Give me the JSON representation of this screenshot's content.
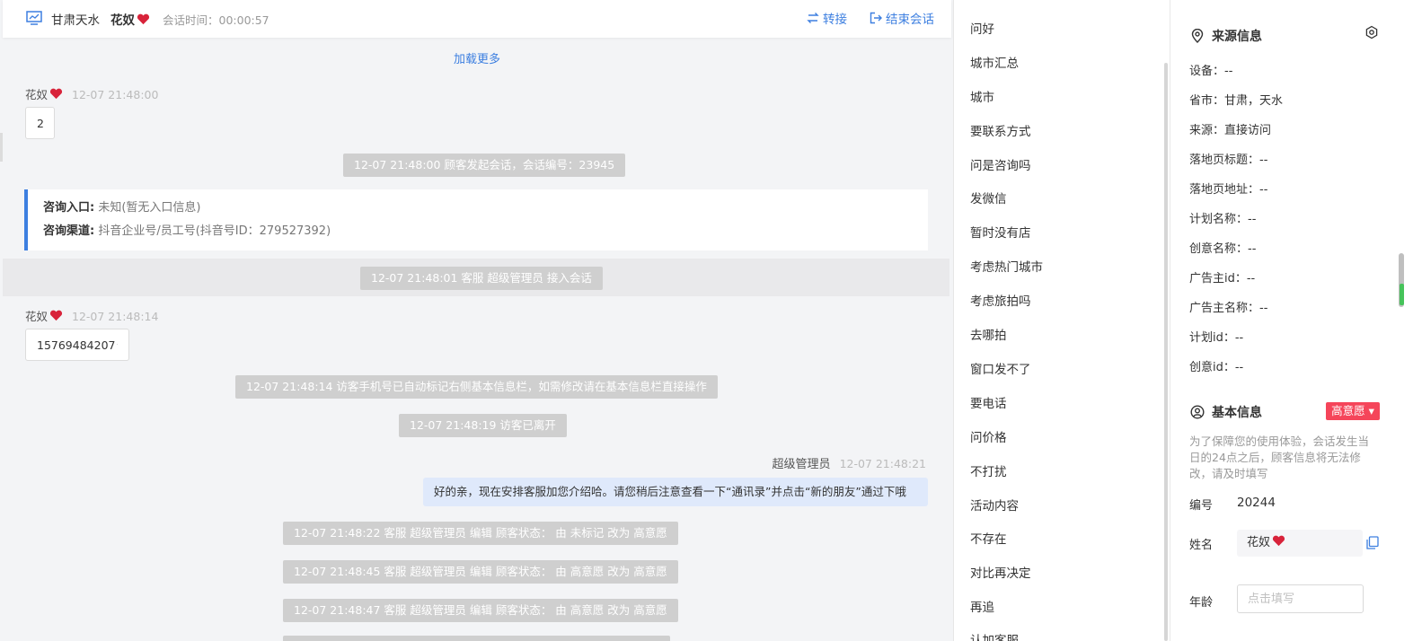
{
  "header": {
    "location": "甘肃天水",
    "visitor_name": "花奴",
    "session_time_label": "会话时间：00:00:57",
    "transfer_label": "转接",
    "end_label": "结束会话"
  },
  "chat": {
    "load_more": "加载更多",
    "msg1": {
      "sender": "花奴",
      "time": "12-07 21:48:00",
      "text": "2"
    },
    "sys1": "12-07 21:48:00 顾客发起会话，会话编号：23945",
    "consult": {
      "entry_label": "咨询入口:",
      "entry_value": "未知(暂无入口信息)",
      "channel_label": "咨询渠道:",
      "channel_value": "抖音企业号/员工号(抖音号ID：279527392)"
    },
    "sys2": "12-07 21:48:01 客服 超级管理员 接入会话",
    "msg2": {
      "sender": "花奴",
      "time": "12-07 21:48:14",
      "text": "15769484207"
    },
    "sys3": "12-07 21:48:14 访客手机号已自动标记右侧基本信息栏，如需修改请在基本信息栏直接操作",
    "sys4": "12-07 21:48:19 访客已离开",
    "agent": {
      "name": "超级管理员",
      "time": "12-07 21:48:21",
      "text": "好的亲，现在安排客服加您介绍哈。请您稍后注意查看一下“通讯录”并点击“新的朋友”通过下哦"
    },
    "sys5": "12-07 21:48:22 客服 超级管理员 编辑 顾客状态： 由 未标记 改为 高意愿",
    "sys6": "12-07 21:48:45 客服 超级管理员 编辑 顾客状态： 由 高意愿 改为 高意愿",
    "sys7": "12-07 21:48:47 客服 超级管理员 编辑 顾客状态： 由 高意愿 改为 高意愿"
  },
  "quick_replies": [
    "问好",
    "城市汇总",
    "城市",
    "要联系方式",
    "问是咨询吗",
    "发微信",
    "暂时没有店",
    "考虑热门城市",
    "考虑旅拍吗",
    "去哪拍",
    "窗口发不了",
    "要电话",
    "问价格",
    "不打扰",
    "活动内容",
    "不存在",
    "对比再决定",
    "再追",
    "认加客服"
  ],
  "source_info": {
    "title": "来源信息",
    "fields": [
      "设备：--",
      "省市：甘肃，天水",
      "来源：直接访问",
      "落地页标题：--",
      "落地页地址：--",
      "计划名称：--",
      "创意名称：--",
      "广告主id：--",
      "广告主名称：--",
      "计划id：--",
      "创意id：--"
    ]
  },
  "basic_info": {
    "title": "基本信息",
    "status_badge": "高意愿 ▾",
    "notice": "为了保障您的使用体验，会话发生当日的24点之后，顾客信息将无法修改，请及时填写",
    "id_label": "编号",
    "id_value": "20244",
    "name_label": "姓名",
    "name_value": "花奴",
    "age_label": "年龄",
    "age_placeholder": "点击填写"
  },
  "colors": {
    "accent": "#3d7fe0",
    "badge": "#f5455a",
    "system_msg": "#cfcfcf",
    "agent_bubble": "#dfe9fb"
  }
}
